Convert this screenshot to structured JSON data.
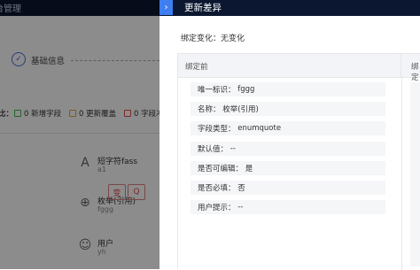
{
  "background": {
    "topbar_title": "台管理",
    "step_label": "基础信息",
    "step_mark": "✓",
    "legend_lead": "比：",
    "legend_items": [
      {
        "label": "0 新增字段",
        "color": "#3bb54a"
      },
      {
        "label": "0 更新覆盖",
        "color": "#f0a030"
      },
      {
        "label": "0 字段冲",
        "color": "#e24a4a"
      }
    ],
    "fields": [
      {
        "icon": "A",
        "name": "短字符fass",
        "sub": "a1"
      },
      {
        "icon": "⊕",
        "name": "枚举(引用)",
        "sub": "fggg"
      },
      {
        "icon": "☺",
        "name": "用户",
        "sub": "yh"
      }
    ],
    "tags": [
      "变",
      "Q"
    ]
  },
  "drawer": {
    "close_icon": "›",
    "title": "更新差异",
    "bind_change_label": "绑定变化：",
    "bind_change_value": "无变化",
    "col_before": "绑定前",
    "col_after": "绑定后",
    "rows": [
      {
        "key": "唯一标识：",
        "value": "fggg"
      },
      {
        "key": "名称：",
        "value": "枚举(引用)"
      },
      {
        "key": "字段类型：",
        "value": "enumquote"
      },
      {
        "key": "默认值：",
        "value": "--"
      },
      {
        "key": "是否可编辑：",
        "value": "是"
      },
      {
        "key": "是否必填：",
        "value": "否"
      },
      {
        "key": "用户提示：",
        "value": "--"
      }
    ]
  }
}
